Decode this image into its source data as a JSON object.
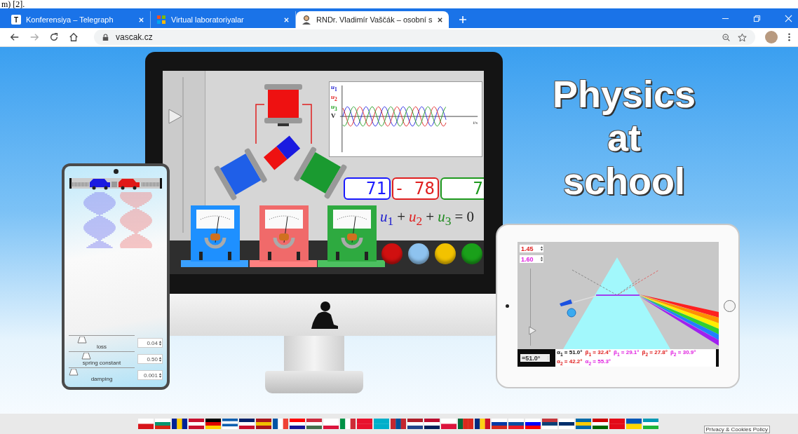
{
  "document_fragment": "m) [2].",
  "tabs": [
    {
      "title": "Konferensiya – Telegraph",
      "selected": false,
      "favicon": {
        "kind": "letter",
        "text": "T"
      }
    },
    {
      "title": "Virtual laboratoriyalar",
      "selected": false,
      "favicon": {
        "kind": "grid"
      }
    },
    {
      "title": "RNDr. Vladimír Vaščák – osobní s",
      "selected": true,
      "favicon": {
        "kind": "avatar"
      }
    }
  ],
  "address_bar": {
    "url": "vascak.cz"
  },
  "hero": {
    "lines": [
      "Physics",
      "at",
      "school"
    ]
  },
  "simulation": {
    "slider": {
      "level": 0.75
    },
    "graph": {
      "y_labels": [
        {
          "text": "*u*$_{1}$",
          "color": "#2020d0"
        },
        {
          "text": "*u*$_{2}$",
          "color": "#e02020"
        },
        {
          "text": "*u*$_{3}$",
          "color": "#20a020"
        },
        {
          "text": "V",
          "color": "#222222"
        }
      ],
      "x_label": "*t*/s"
    },
    "displays": [
      {
        "value": "71",
        "color": "#1a1aff"
      },
      {
        "value": "- 78",
        "color": "#e02020"
      },
      {
        "value": "7",
        "color": "#1f9a1f"
      }
    ],
    "equation": [
      {
        "text": "*u*$_{1}$",
        "color": "#2020d0"
      },
      {
        "text": "+",
        "color": "#222222"
      },
      {
        "text": "*u*$_{2}$",
        "color": "#e02020"
      },
      {
        "text": "+",
        "color": "#222222"
      },
      {
        "text": "*u*$_{3}$",
        "color": "#1f8a1f"
      },
      {
        "text": "= 0",
        "color": "#222222"
      }
    ],
    "lamp_buttons": [
      {
        "color": "#d01010"
      },
      {
        "color": "#8ec3ef"
      },
      {
        "color": "#f2c200"
      },
      {
        "color": "#1aa01a"
      }
    ]
  },
  "phone": {
    "sliders": [
      {
        "label": "loss",
        "value": "0.04",
        "level": 0.15
      },
      {
        "label": "spring constant",
        "value": "0.50",
        "level": 0.22
      },
      {
        "label": "damping",
        "value": "0.001",
        "level": 0
      }
    ]
  },
  "tablet": {
    "inputs": [
      {
        "value": "1.45",
        "color": "#e02020"
      },
      {
        "value": "1.60",
        "color": "#e020e0"
      }
    ],
    "slider": {
      "level": 0.2
    },
    "angle_input": "=51.0°",
    "readouts": [
      {
        "text": "α$_{1}$ = 51.0°",
        "color": "#111111"
      },
      {
        "text": "β$_{1}$ = 32.4°",
        "color": "#e02020"
      },
      {
        "text": "β$_{1}$ = 29.1°",
        "color": "#e020e0"
      },
      {
        "text": "β$_{2}$ = 27.8°",
        "color": "#e02020"
      },
      {
        "text": "β$_{2}$ = 30.9°",
        "color": "#e020e0"
      },
      {
        "text": "α$_{2}$ = 42.2°",
        "color": "#e02020"
      },
      {
        "text": "α$_{2}$ = 55.3°",
        "color": "#e020e0"
      }
    ]
  },
  "footer": {
    "privacy_link": "Privacy & Cookies Policy"
  }
}
